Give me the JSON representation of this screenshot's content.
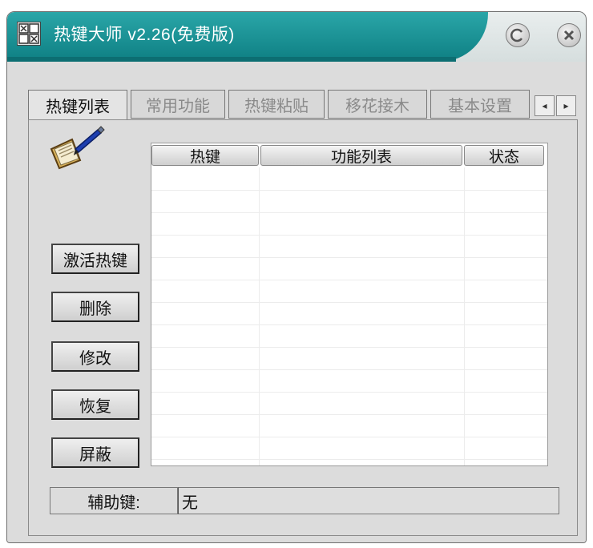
{
  "window": {
    "title": "热键大师 v2.26(免费版)",
    "app_icon": "hotkey-grid-icon",
    "minimize_icon": "minimize-icon",
    "close_icon": "close-icon"
  },
  "tabs": [
    {
      "label": "热键列表",
      "active": true
    },
    {
      "label": "常用功能",
      "active": false
    },
    {
      "label": "热键粘贴",
      "active": false
    },
    {
      "label": "移花接木",
      "active": false
    },
    {
      "label": "基本设置",
      "active": false
    }
  ],
  "tab_scroll": {
    "left_icon": "chevron-left-icon",
    "right_icon": "chevron-right-icon"
  },
  "list": {
    "columns": [
      "热键",
      "功能列表",
      "状态"
    ],
    "rows": []
  },
  "buttons": {
    "activate": "激活热键",
    "delete": "删除",
    "modify": "修改",
    "restore": "恢复",
    "mask": "屏蔽"
  },
  "modifier": {
    "label": "辅助键:",
    "value": "无"
  },
  "colors": {
    "title_teal": "#0e7f83",
    "window_bg": "#dcdcdc"
  }
}
